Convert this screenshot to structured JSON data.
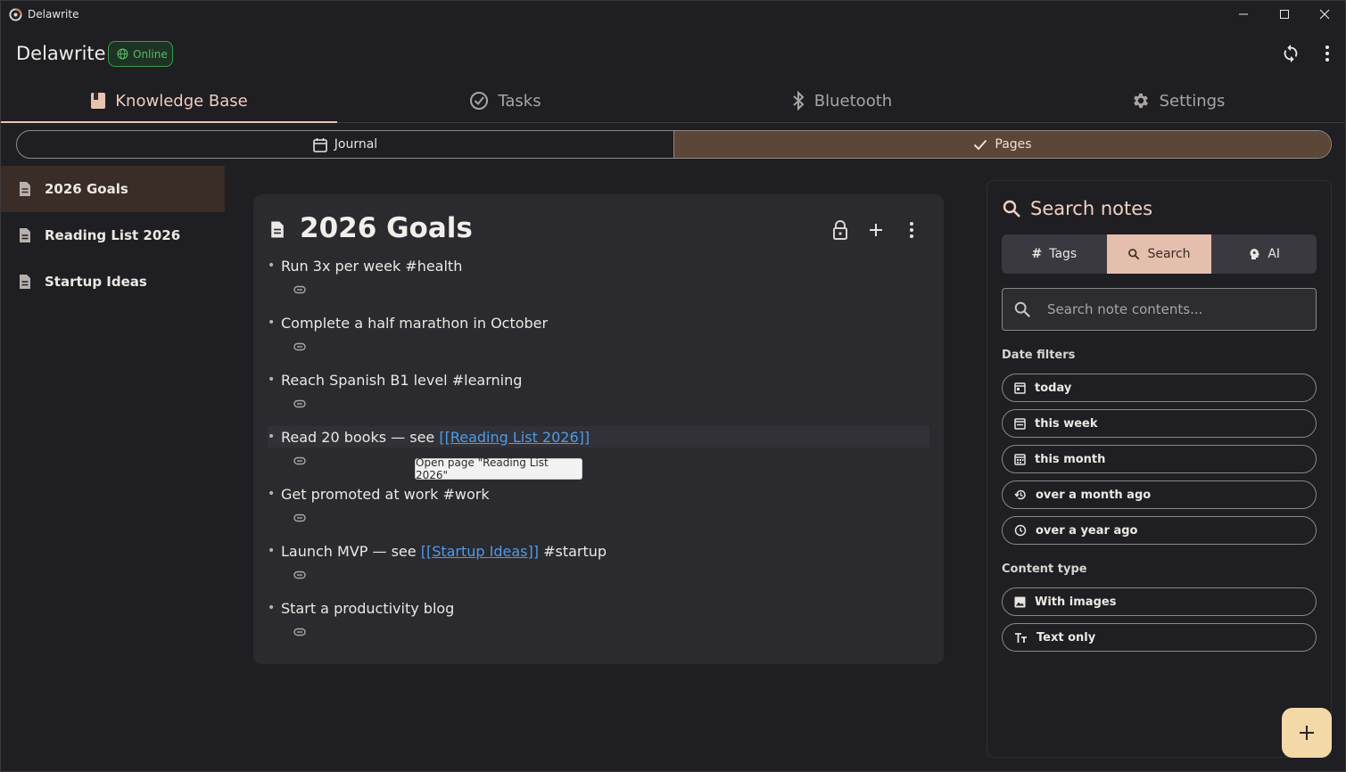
{
  "window": {
    "title": "Delawrite",
    "minimize_icon": "minimize-icon",
    "maximize_icon": "maximize-icon",
    "close_icon": "close-icon"
  },
  "header": {
    "app_title": "Delawrite",
    "status_badge": "Online",
    "sync_icon": "sync-icon",
    "menu_icon": "more-vertical-icon"
  },
  "tabs": [
    {
      "label": "Knowledge Base",
      "icon": "book-icon",
      "active": true
    },
    {
      "label": "Tasks",
      "icon": "check-circle-icon",
      "active": false
    },
    {
      "label": "Bluetooth",
      "icon": "bluetooth-icon",
      "active": false
    },
    {
      "label": "Settings",
      "icon": "gear-icon",
      "active": false
    }
  ],
  "view_toggle": {
    "journal_label": "Journal",
    "pages_label": "Pages",
    "selected": "Pages"
  },
  "sidebar": {
    "items": [
      {
        "label": "2026 Goals",
        "active": true
      },
      {
        "label": "Reading List 2026",
        "active": false
      },
      {
        "label": "Startup Ideas",
        "active": false
      }
    ]
  },
  "note": {
    "title": "2026 Goals",
    "bullets": [
      {
        "before": "Run 3x per week #health",
        "link": "",
        "after": ""
      },
      {
        "before": "Complete a half marathon in October",
        "link": "",
        "after": ""
      },
      {
        "before": "Reach Spanish B1 level #learning",
        "link": "",
        "after": ""
      },
      {
        "before": "Read 20 books — see ",
        "link": "[[Reading List 2026]]",
        "after": ""
      },
      {
        "before": "Get promoted at work #work",
        "link": "",
        "after": ""
      },
      {
        "before": "Launch MVP — see ",
        "link": "[[Startup Ideas]]",
        "after": " #startup"
      },
      {
        "before": "Start a productivity blog",
        "link": "",
        "after": ""
      }
    ],
    "tooltip": "Open page \"Reading List 2026\""
  },
  "search_panel": {
    "title": "Search notes",
    "tabs": [
      {
        "label": "Tags",
        "icon": "hash-icon",
        "active": false
      },
      {
        "label": "Search",
        "icon": "search-icon",
        "active": true
      },
      {
        "label": "AI",
        "icon": "brain-icon",
        "active": false
      }
    ],
    "search_placeholder": "Search note contents...",
    "date_filters_label": "Date filters",
    "date_filters": [
      {
        "label": "today",
        "icon": "calendar-today-icon"
      },
      {
        "label": "this week",
        "icon": "calendar-week-icon"
      },
      {
        "label": "this month",
        "icon": "calendar-month-icon"
      },
      {
        "label": "over a month ago",
        "icon": "history-icon"
      },
      {
        "label": "over a year ago",
        "icon": "clock-icon"
      }
    ],
    "content_type_label": "Content type",
    "content_types": [
      {
        "label": "With images",
        "icon": "image-icon"
      },
      {
        "label": "Text only",
        "icon": "text-icon"
      }
    ]
  },
  "fab": {
    "icon": "plus-icon"
  },
  "colors": {
    "accent": "#e8c3b4",
    "online": "#59b86a",
    "link": "#4c9ce8",
    "fab": "#f3d8a8"
  }
}
